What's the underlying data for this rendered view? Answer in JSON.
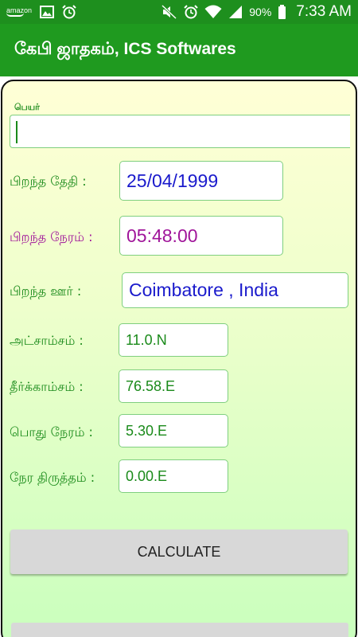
{
  "status_bar": {
    "amazon_label": "amazon",
    "battery_percent": "90%",
    "time": "7:33 AM",
    "bg_color": "#1e8f1e"
  },
  "app_bar": {
    "title": "கேபி ஜாதகம், ICS Softwares",
    "bg_color": "#1f9a1f"
  },
  "form": {
    "name_label": "பெயர்",
    "name_value": "",
    "birth_date_label": "பிறந்த தேதி :",
    "birth_date_value": "25/04/1999",
    "birth_time_label": "பிறந்த நேரம் :",
    "birth_time_value": "05:48:00",
    "birth_place_label": "பிறந்த ஊர் :",
    "birth_place_value": "Coimbatore , India",
    "latitude_label": "அட்சாம்சம் :",
    "latitude_value": "11.0.N",
    "longitude_label": "தீர்க்காம்சம் :",
    "longitude_value": "76.58.E",
    "standard_time_label": "பொது நேரம் :",
    "standard_time_value": "5.30.E",
    "time_correction_label": "நேர திருத்தம் :",
    "time_correction_value": "0.00.E",
    "calculate_label": "CALCULATE"
  },
  "colors": {
    "label_green": "#1a8a1a",
    "value_blue": "#1a1acc",
    "value_purple": "#a0159a"
  }
}
